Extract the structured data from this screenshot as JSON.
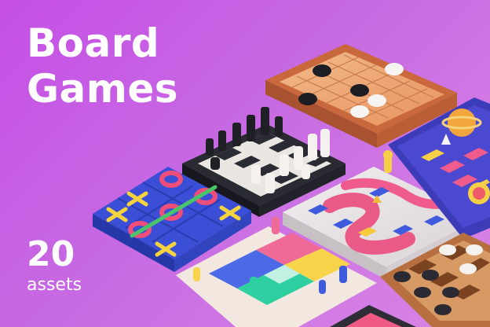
{
  "banner": {
    "title_line1": "Board",
    "title_line2": "Games",
    "asset_count": "20",
    "asset_unit": "assets"
  },
  "colors": {
    "background": "#c64fe6",
    "text": "#ffffff"
  },
  "illustration": {
    "items": [
      "go-board-icon",
      "chess-board-icon",
      "tic-tac-toe-board-icon",
      "snakes-and-ladders-board-icon",
      "space-race-board-icon",
      "ludo-board-icon",
      "checkers-board-icon",
      "backgammon-board-icon"
    ]
  }
}
